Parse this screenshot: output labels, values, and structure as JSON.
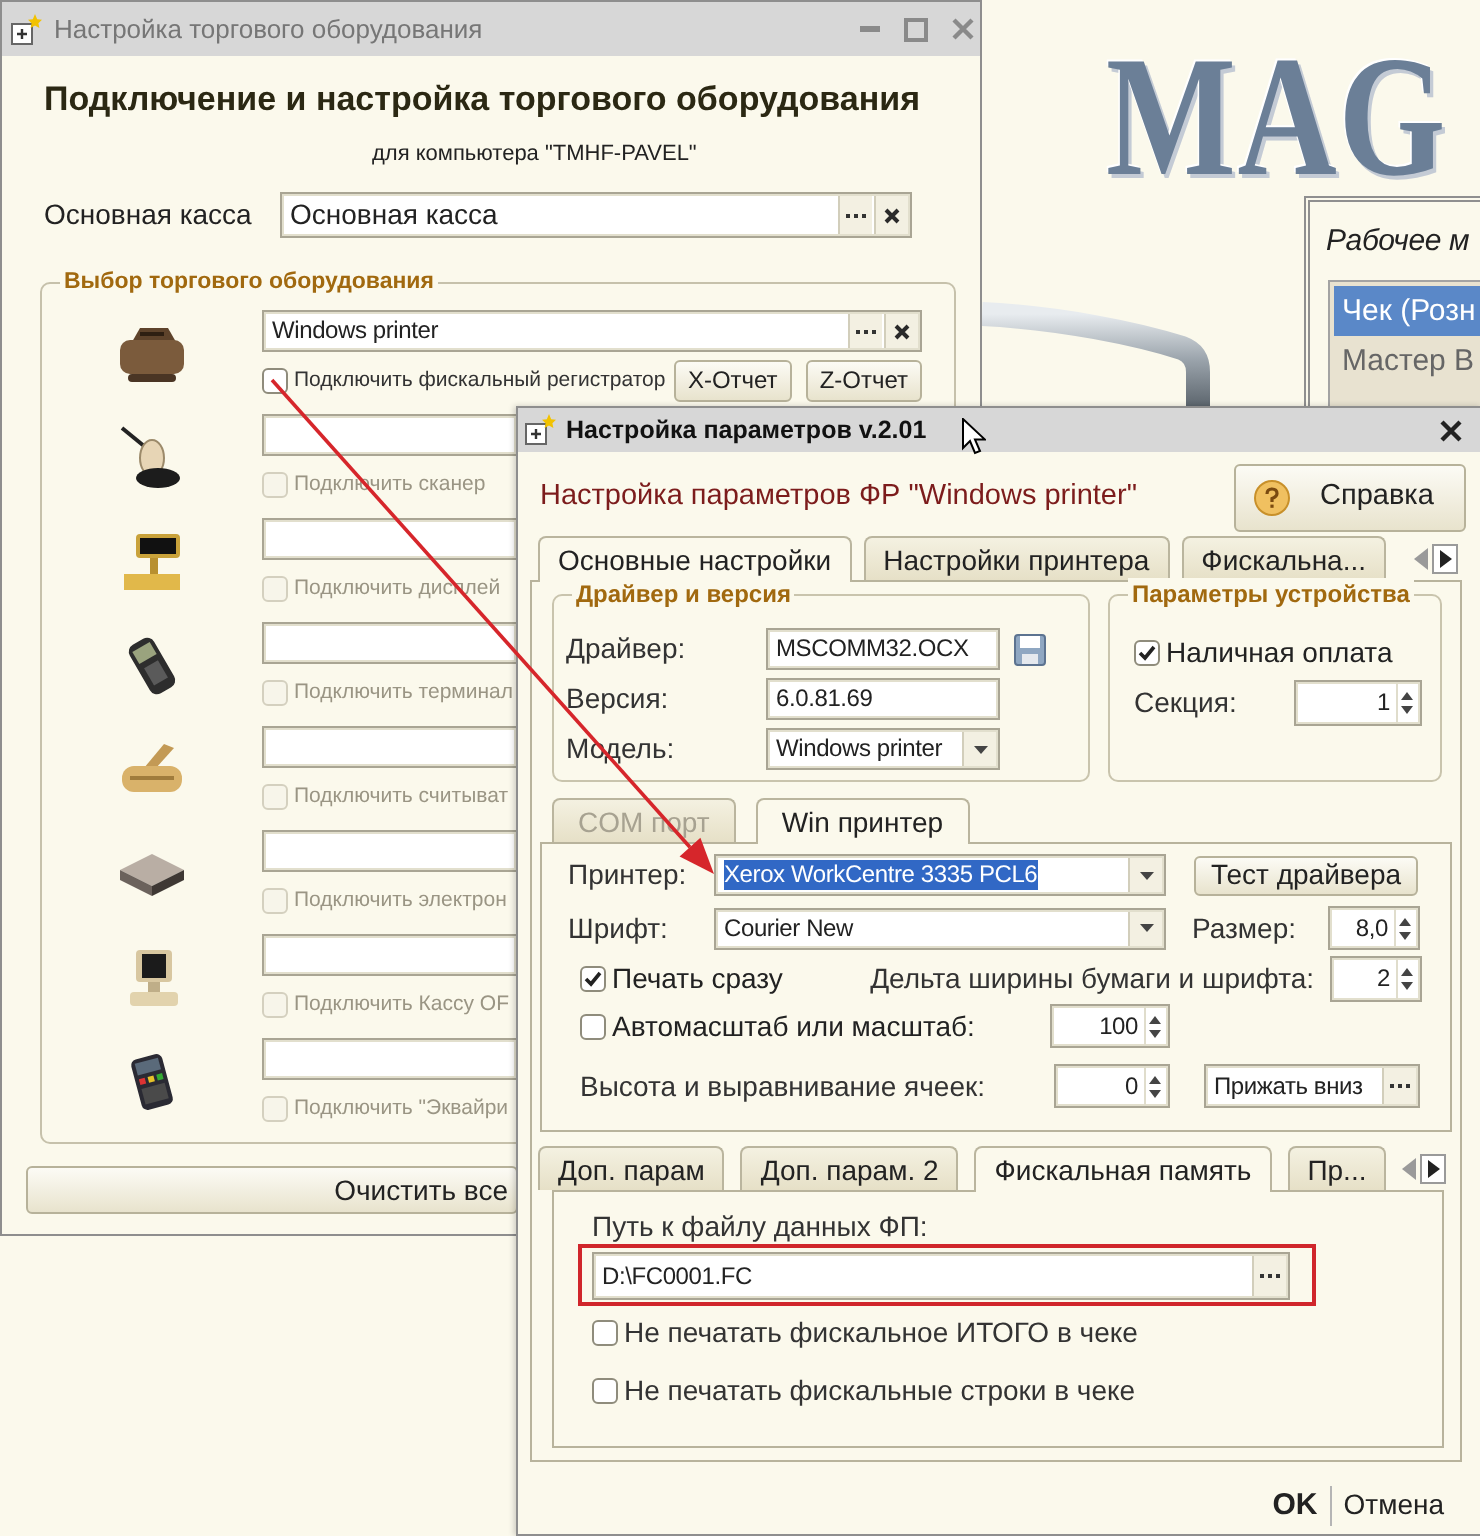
{
  "equipment_window": {
    "title": "Настройка торгового оборудования",
    "active": false,
    "heading": "Подключение и настройка торгового оборудования",
    "subtitle": "для компьютера \"TMHF-PAVEL\"",
    "main_register": {
      "label": "Основная касса",
      "value": "Основная касса"
    },
    "group_title": "Выбор торгового оборудования",
    "devices": [
      {
        "kind": "fiscal_printer",
        "value": "Windows printer",
        "option": "Подключить фискальный регистратор",
        "checked": false,
        "disabled": false,
        "buttons": [
          "X-Отчет",
          "Z-Отчет"
        ]
      },
      {
        "kind": "scanner",
        "option": "Подключить сканер",
        "checked": false,
        "disabled": true
      },
      {
        "kind": "display",
        "option": "Подключить дисплей",
        "checked": false,
        "disabled": true
      },
      {
        "kind": "terminal",
        "option": "Подключить терминал",
        "checked": false,
        "disabled": true
      },
      {
        "kind": "reader",
        "option": "Подключить считыват",
        "checked": false,
        "disabled": true
      },
      {
        "kind": "scale",
        "option": "Подключить электрон",
        "checked": false,
        "disabled": true
      },
      {
        "kind": "pos",
        "option": "Подключить Кассу OF",
        "checked": false,
        "disabled": true
      },
      {
        "kind": "acquiring",
        "option": "Подключить \"Эквайри",
        "checked": false,
        "disabled": true
      }
    ],
    "clear_button": "Очистить все"
  },
  "background_app": {
    "logo": "MAG",
    "panel_title": "Рабочее м",
    "items": [
      {
        "label": "Чек (Розн",
        "selected": true
      },
      {
        "label": "Мастер В",
        "selected": false
      }
    ]
  },
  "params_dialog": {
    "title": "Настройка параметров v.2.01",
    "active": true,
    "heading": "Настройка параметров ФР \"Windows printer\"",
    "help_button": "Справка",
    "tabs": [
      {
        "label": "Основные настройки",
        "selected": true
      },
      {
        "label": "Настройки принтера",
        "selected": false
      },
      {
        "label": "Фискальна...",
        "selected": false
      }
    ],
    "driver_group": {
      "title": "Драйвер и версия",
      "fields": [
        {
          "kind": "file",
          "label": "Драйвер:",
          "value": "MSCOMM32.OCX"
        },
        {
          "kind": "text",
          "label": "Версия:",
          "value": "6.0.81.69"
        },
        {
          "kind": "combo",
          "label": "Модель:",
          "value": "Windows printer"
        }
      ]
    },
    "device_group": {
      "title": "Параметры устройства",
      "cash_payment": {
        "label": "Наличная оплата",
        "checked": true
      },
      "section": {
        "label": "Секция:",
        "value": "1"
      }
    },
    "port_tabs": [
      {
        "label": "COM порт",
        "selected": false,
        "disabled": true
      },
      {
        "label": "Win принтер",
        "selected": true,
        "disabled": false
      }
    ],
    "printer": {
      "label": "Принтер:",
      "value": "Xerox WorkCentre 3335 PCL6",
      "highlighted": true
    },
    "test_button": "Тест драйвера",
    "font": {
      "label": "Шрифт:",
      "value": "Courier New"
    },
    "size": {
      "label": "Размер:",
      "value": "8,0"
    },
    "print_now": {
      "label": "Печать сразу",
      "checked": true
    },
    "width_delta": {
      "label": "Дельта ширины бумаги и шрифта:",
      "value": "2"
    },
    "autoscale": {
      "label": "Автомасштаб или масштаб:",
      "checked": false,
      "value": "100"
    },
    "cell_height": {
      "label": "Высота и выравнивание ячеек:",
      "value": "0",
      "alignment": "Прижать вниз"
    },
    "extra_tabs": [
      {
        "label": "Доп. парам",
        "selected": false
      },
      {
        "label": "Доп. парам. 2",
        "selected": false
      },
      {
        "label": "Фискальная память",
        "selected": true
      },
      {
        "label": "Пр...",
        "selected": false
      }
    ],
    "fiscal_memory": {
      "path_label": "Путь к файлу данных ФП:",
      "path_value": "D:\\FC0001.FC",
      "highlighted": true,
      "options": [
        {
          "label": "Не печатать фискальное ИТОГО в чеке",
          "checked": false
        },
        {
          "label": "Не печатать фискальные строки в чеке",
          "checked": false
        }
      ]
    },
    "footer_buttons": [
      {
        "label": "OK",
        "default": true
      },
      {
        "label": "Отмена",
        "default": false
      }
    ]
  },
  "annotation_arrow": true
}
